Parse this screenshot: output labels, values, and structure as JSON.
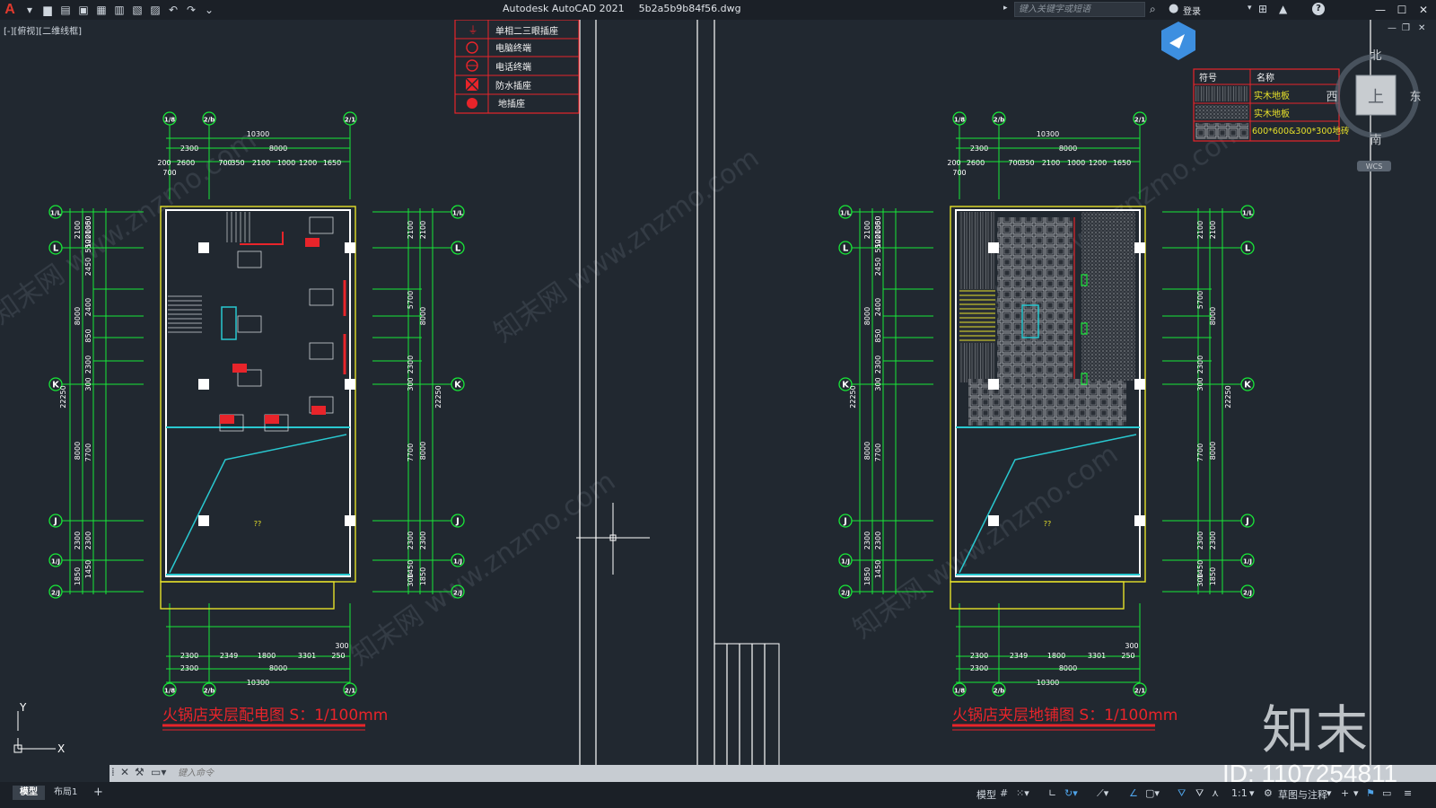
{
  "app": {
    "name": "Autodesk AutoCAD 2021",
    "file": "5b2a5b9b84f56.dwg",
    "logo_glyph": "A",
    "search_placeholder": "键入关键字或短语",
    "login_label": "登录"
  },
  "viewport": {
    "label": "[-][俯视][二维线框]"
  },
  "legend_symbols": {
    "items": [
      {
        "icon": "single-phase-socket-icon",
        "label": "单相二三眼插座"
      },
      {
        "icon": "computer-terminal-icon",
        "label": "电脑终端"
      },
      {
        "icon": "phone-terminal-icon",
        "label": "电话终端"
      },
      {
        "icon": "waterproof-socket-icon",
        "label": "防水插座"
      },
      {
        "icon": "floor-socket-icon",
        "label": "地插座"
      }
    ]
  },
  "legend_materials": {
    "header_symbol": "符号",
    "header_name": "名称",
    "rows": [
      {
        "icon": "hatch-wood-icon",
        "label": "实木地板"
      },
      {
        "icon": "hatch-wood-icon",
        "label": "实木地板"
      },
      {
        "icon": "hatch-tile-icon",
        "label": "600*600&300*300地砖"
      }
    ]
  },
  "viewcube": {
    "north": "北",
    "south": "南",
    "east": "东",
    "west": "西",
    "top": "上",
    "wcs": "WCS"
  },
  "plan_left": {
    "title": "火锅店夹层配电图 S：1/100mm",
    "room_tag": "??"
  },
  "plan_right": {
    "title": "火锅店夹层地铺图 S：1/100mm",
    "room_tag": "??"
  },
  "dims": {
    "top_total": "10300",
    "top_a": "2300",
    "top_b": "8000",
    "top_row": [
      "200",
      "2600",
      "700",
      "350",
      "2100",
      "1000",
      "1200",
      "1650"
    ],
    "top_small": "700",
    "bottom_row": [
      "2300",
      "2349",
      "1800",
      "3301",
      "250"
    ],
    "bottom_small": "300",
    "bottom_a": "2300",
    "bottom_b": "8000",
    "bottom_total": "10300",
    "left_total": "22250",
    "left_outer": [
      "2100",
      "8000",
      "8000",
      "2300",
      "1850"
    ],
    "left_inner": [
      "2100",
      "550",
      "1200",
      "350",
      "2450",
      "2400",
      "850",
      "2300",
      "300",
      "7700",
      "2300",
      "1450",
      "250",
      "1500"
    ],
    "right_inner": [
      "2100",
      "5700",
      "2300",
      "300",
      "7700",
      "2300",
      "1450",
      "300"
    ],
    "right_outer": [
      "2100",
      "8000",
      "8000",
      "2300",
      "1850"
    ],
    "inner_misc": [
      "300",
      "300",
      "1500"
    ]
  },
  "grid_labels": {
    "top": [
      "1/8",
      "2/b",
      "2/1"
    ],
    "side": [
      "1/L",
      "L",
      "K",
      "J",
      "1/J",
      "2/J"
    ]
  },
  "axis": {
    "x": "X",
    "y": "Y"
  },
  "command": {
    "placeholder": "键入命令"
  },
  "layout_tabs": {
    "model": "模型",
    "layout1": "布局1",
    "add": "+"
  },
  "status": {
    "model": "模型",
    "scale": "1:1",
    "workspace": "草图与注释"
  },
  "watermark": {
    "id": "ID: 1107254811",
    "brand": "知末",
    "site": "知末网 www.znzmo.com"
  },
  "colors": {
    "bg": "#212830",
    "grid_line": "#18e838",
    "wall": "#ffffff",
    "accent_cyan": "#29c8d0",
    "accent_red": "#e8242a",
    "accent_yellow": "#e6e02a",
    "title_red": "#e8242a"
  }
}
